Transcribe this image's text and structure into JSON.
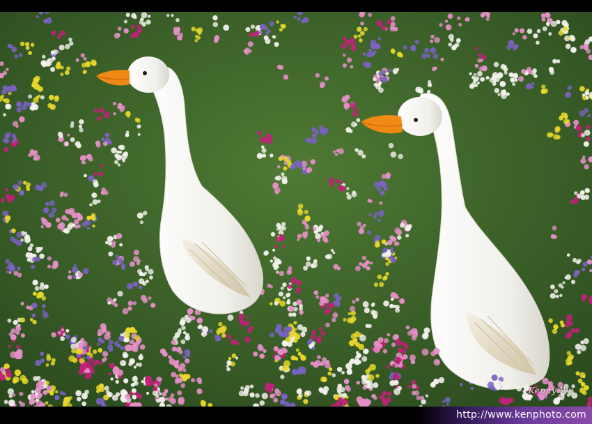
{
  "photo": {
    "subject": "two white duck statues in flower garden",
    "colors": {
      "foliage": "#3f6b2a",
      "white_bloom": "#f4f2ee",
      "magenta_bloom": "#c2207a",
      "pink_bloom": "#e58fc8",
      "purple_bloom": "#7b62c4",
      "yellow_bloom": "#e8d82a",
      "beak": "#f08a14",
      "duck_body": "#f2f1ec"
    }
  },
  "watermark": {
    "signature": "Kenny Wu",
    "url": "http://www.kenphoto.com"
  },
  "colors": {
    "footer_accent": "#6a3a9a"
  }
}
